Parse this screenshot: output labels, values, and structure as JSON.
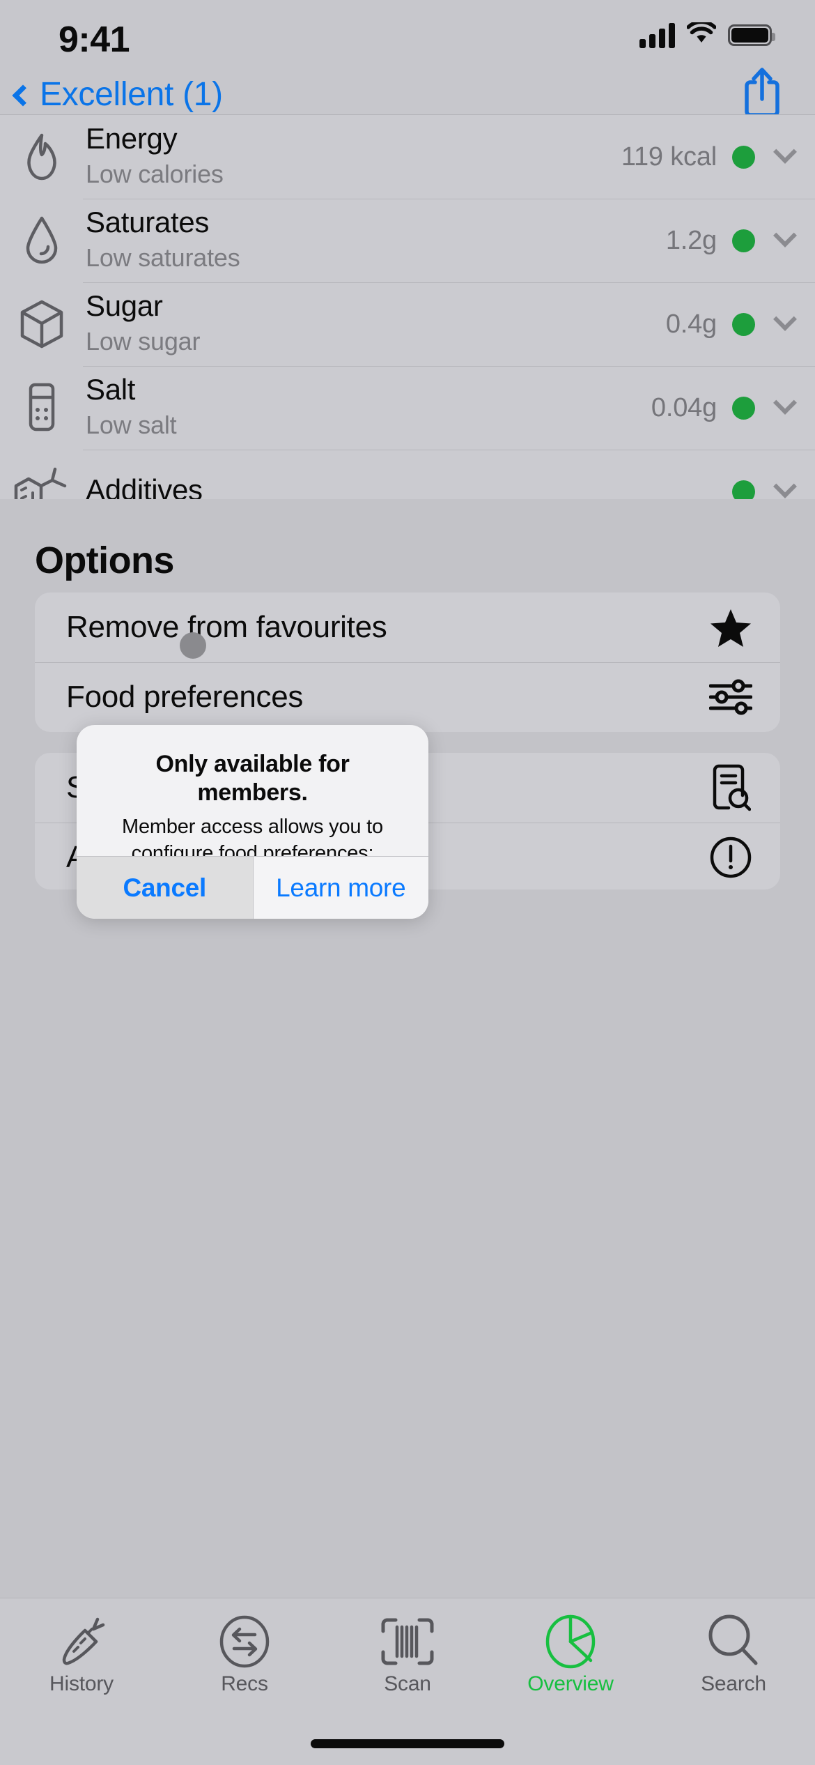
{
  "status_bar": {
    "time": "9:41",
    "signal_icon": "cellular-signal-icon",
    "wifi_icon": "wifi-icon",
    "battery_icon": "battery-icon"
  },
  "nav_bar": {
    "back_label": "Excellent (1)",
    "back_icon": "chevron-left-icon",
    "share_icon": "share-icon"
  },
  "nutrition": {
    "rows": [
      {
        "icon": "flame-icon",
        "title": "Energy",
        "subtitle": "Low calories",
        "value": "119 kcal",
        "status_color": "#1d9e3c",
        "chevron": "chevron-down-icon"
      },
      {
        "icon": "droplet-icon",
        "title": "Saturates",
        "subtitle": "Low saturates",
        "value": "1.2g",
        "status_color": "#1d9e3c",
        "chevron": "chevron-down-icon"
      },
      {
        "icon": "sugar-cube-icon",
        "title": "Sugar",
        "subtitle": "Low sugar",
        "value": "0.4g",
        "status_color": "#1d9e3c",
        "chevron": "chevron-down-icon"
      },
      {
        "icon": "salt-shaker-icon",
        "title": "Salt",
        "subtitle": "Low salt",
        "value": "0.04g",
        "status_color": "#1d9e3c",
        "chevron": "chevron-down-icon"
      },
      {
        "icon": "molecule-icon",
        "title": "Additives",
        "subtitle": "",
        "value": "",
        "status_color": "#1d9e3c",
        "chevron": "chevron-down-icon"
      }
    ]
  },
  "options": {
    "title": "Options",
    "group_one": [
      {
        "label": "Remove from favourites",
        "icon": "star-filled-icon"
      },
      {
        "label": "Food preferences",
        "icon": "sliders-icon"
      }
    ],
    "group_two": [
      {
        "label": "Scoring method",
        "icon": "document-search-icon"
      },
      {
        "label": "An issue with this product?",
        "icon": "exclamation-circle-icon"
      }
    ]
  },
  "alert": {
    "title": "Only available for members.",
    "message": "Member access allows you to configure food preferences: gluten-free, lactose-free and/or palm-oil free.",
    "cancel_label": "Cancel",
    "confirm_label": "Learn more",
    "accent_color": "#0a7aff"
  },
  "tab_bar": {
    "active_color": "#17bf40",
    "tabs": [
      {
        "label": "History",
        "icon": "carrot-icon",
        "active": false
      },
      {
        "label": "Recs",
        "icon": "swap-circle-icon",
        "active": false
      },
      {
        "label": "Scan",
        "icon": "barcode-scan-icon",
        "active": false
      },
      {
        "label": "Overview",
        "icon": "pie-chart-icon",
        "active": true
      },
      {
        "label": "Search",
        "icon": "magnifier-icon",
        "active": false
      }
    ]
  }
}
